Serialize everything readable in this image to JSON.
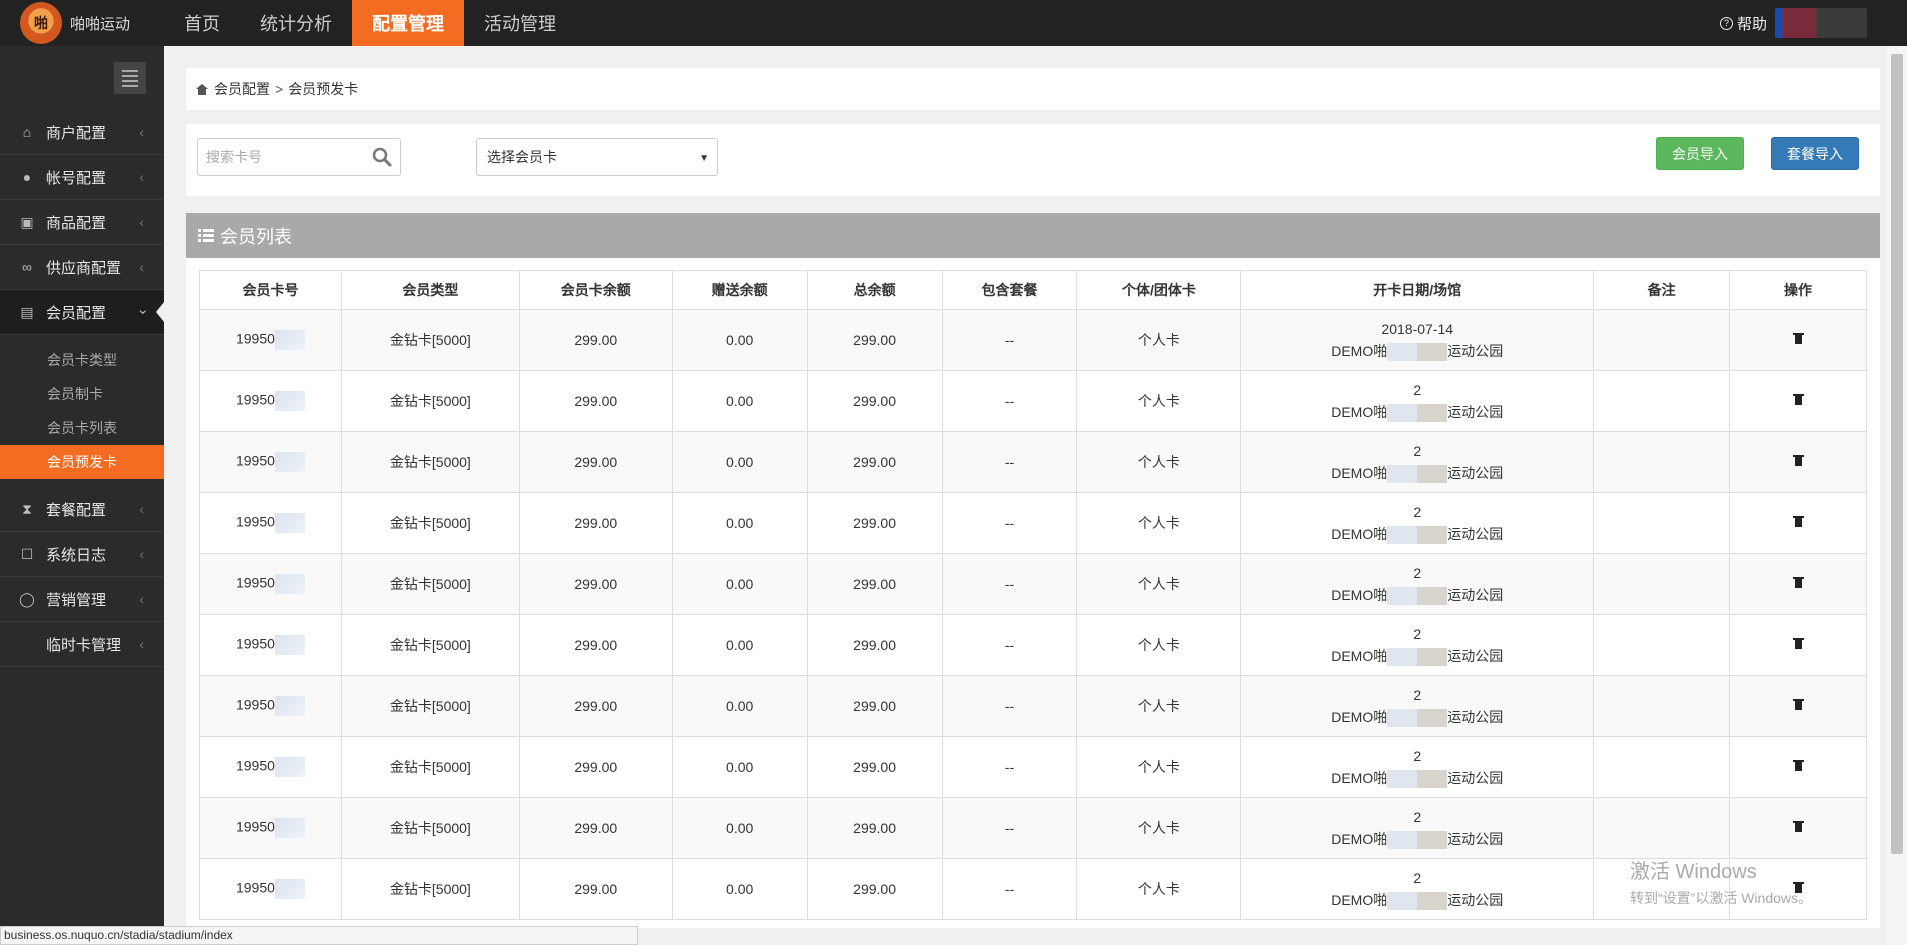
{
  "brand": {
    "name": "啪啪运动",
    "logo_text": "啪"
  },
  "topnav": [
    {
      "label": "首页"
    },
    {
      "label": "统计分析"
    },
    {
      "label": "配置管理"
    },
    {
      "label": "活动管理"
    }
  ],
  "help_label": "帮助",
  "sidebar": {
    "items": [
      {
        "label": "商户配置",
        "icon": "home-icon"
      },
      {
        "label": "帐号配置",
        "icon": "user-icon"
      },
      {
        "label": "商品配置",
        "icon": "gift-icon"
      },
      {
        "label": "供应商配置",
        "icon": "link-icon"
      },
      {
        "label": "会员配置",
        "icon": "id-card-icon"
      }
    ],
    "sub_items": [
      {
        "label": "会员卡类型"
      },
      {
        "label": "会员制卡"
      },
      {
        "label": "会员卡列表"
      },
      {
        "label": "会员预发卡"
      }
    ],
    "more_items": [
      {
        "label": "套餐配置",
        "icon": "hourglass-icon"
      },
      {
        "label": "系统日志",
        "icon": "log-icon"
      },
      {
        "label": "营销管理",
        "icon": "chat-icon"
      },
      {
        "label": "临时卡管理",
        "icon": ""
      }
    ]
  },
  "breadcrumb": {
    "root": "会员配置",
    "sep": ">",
    "current": "会员预发卡"
  },
  "toolbar": {
    "search_placeholder": "搜索卡号",
    "select_value": "选择会员卡",
    "import_member_label": "会员导入",
    "import_package_label": "套餐导入"
  },
  "panel_title": "会员列表",
  "table": {
    "headers": [
      "会员卡号",
      "会员类型",
      "会员卡余额",
      "赠送余额",
      "总余额",
      "包含套餐",
      "个体/团体卡",
      "开卡日期/场馆",
      "备注",
      "操作"
    ],
    "rows": [
      {
        "card": "19950",
        "type": "金钻卡[5000]",
        "balance": "299.00",
        "gift": "0.00",
        "total": "299.00",
        "package": "--",
        "kind": "个人卡",
        "date": "2018-07-14",
        "venue_prefix": "DEMO啪",
        "venue_suffix": "运动公园",
        "note": ""
      },
      {
        "card": "19950",
        "type": "金钻卡[5000]",
        "balance": "299.00",
        "gift": "0.00",
        "total": "299.00",
        "package": "--",
        "kind": "个人卡",
        "date": "2",
        "venue_prefix": "DEMO啪",
        "venue_suffix": "运动公园",
        "note": ""
      },
      {
        "card": "19950",
        "type": "金钻卡[5000]",
        "balance": "299.00",
        "gift": "0.00",
        "total": "299.00",
        "package": "--",
        "kind": "个人卡",
        "date": "2",
        "venue_prefix": "DEMO啪",
        "venue_suffix": "运动公园",
        "note": ""
      },
      {
        "card": "19950",
        "type": "金钻卡[5000]",
        "balance": "299.00",
        "gift": "0.00",
        "total": "299.00",
        "package": "--",
        "kind": "个人卡",
        "date": "2",
        "venue_prefix": "DEMO啪",
        "venue_suffix": "运动公园",
        "note": ""
      },
      {
        "card": "19950",
        "type": "金钻卡[5000]",
        "balance": "299.00",
        "gift": "0.00",
        "total": "299.00",
        "package": "--",
        "kind": "个人卡",
        "date": "2",
        "venue_prefix": "DEMO啪",
        "venue_suffix": "运动公园",
        "note": ""
      },
      {
        "card": "19950",
        "type": "金钻卡[5000]",
        "balance": "299.00",
        "gift": "0.00",
        "total": "299.00",
        "package": "--",
        "kind": "个人卡",
        "date": "2",
        "venue_prefix": "DEMO啪",
        "venue_suffix": "运动公园",
        "note": ""
      },
      {
        "card": "19950",
        "type": "金钻卡[5000]",
        "balance": "299.00",
        "gift": "0.00",
        "total": "299.00",
        "package": "--",
        "kind": "个人卡",
        "date": "2",
        "venue_prefix": "DEMO啪",
        "venue_suffix": "运动公园",
        "note": ""
      },
      {
        "card": "19950",
        "type": "金钻卡[5000]",
        "balance": "299.00",
        "gift": "0.00",
        "total": "299.00",
        "package": "--",
        "kind": "个人卡",
        "date": "2",
        "venue_prefix": "DEMO啪",
        "venue_suffix": "运动公园",
        "note": ""
      },
      {
        "card": "19950",
        "type": "金钻卡[5000]",
        "balance": "299.00",
        "gift": "0.00",
        "total": "299.00",
        "package": "--",
        "kind": "个人卡",
        "date": "2",
        "venue_prefix": "DEMO啪",
        "venue_suffix": "运动公园",
        "note": ""
      },
      {
        "card": "19950",
        "type": "金钻卡[5000]",
        "balance": "299.00",
        "gift": "0.00",
        "total": "299.00",
        "package": "--",
        "kind": "个人卡",
        "date": "2",
        "venue_prefix": "DEMO啪",
        "venue_suffix": "运动公园",
        "note": ""
      }
    ]
  },
  "watermark": {
    "line1": "激活 Windows",
    "line2": "转到“设置”以激活 Windows。"
  },
  "status_url": "business.os.nuquo.cn/stadia/stadium/index",
  "colors": {
    "accent": "#f36c21",
    "green": "#5cb85c",
    "blue": "#337ab7",
    "topbar": "#222222",
    "sidebar": "#2b2b2b"
  }
}
